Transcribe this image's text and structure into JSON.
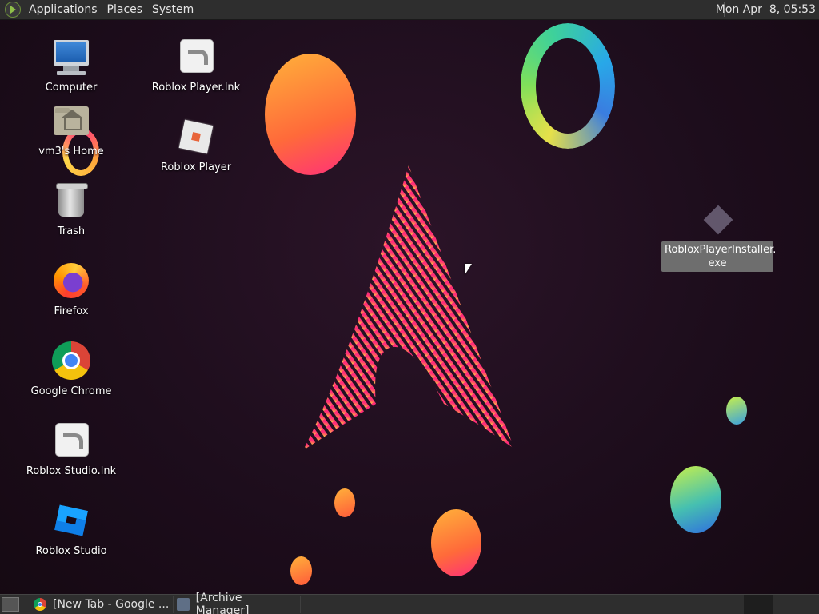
{
  "top_panel": {
    "menus": [
      "Applications",
      "Places",
      "System"
    ],
    "clock": "Mon Apr  8, 05:53"
  },
  "desktop": {
    "icons": [
      {
        "label": "Computer",
        "icon": "computer-icon"
      },
      {
        "label": "vm3's Home",
        "icon": "home-folder-icon"
      },
      {
        "label": "Trash",
        "icon": "trash-icon"
      },
      {
        "label": "Firefox",
        "icon": "firefox-icon"
      },
      {
        "label": "Google Chrome",
        "icon": "chrome-icon"
      },
      {
        "label": "Roblox Studio.lnk",
        "icon": "shortcut-icon"
      },
      {
        "label": "Roblox Studio",
        "icon": "roblox-studio-icon"
      },
      {
        "label": "Roblox Player.lnk",
        "icon": "shortcut-icon"
      },
      {
        "label": "Roblox Player",
        "icon": "roblox-player-icon"
      },
      {
        "label": "RobloxPlayerInstaller.\nexe",
        "icon": "installer-icon"
      }
    ]
  },
  "taskbar": {
    "tasks": [
      {
        "label": "[New Tab - Google ...",
        "icon": "chrome-icon"
      },
      {
        "label": "[Archive Manager]",
        "icon": "archive-manager-icon"
      }
    ]
  },
  "colors": {
    "panel": "#2e2e2e",
    "desktop_bg": "#1d0d1c",
    "accent_pink": "#ff2d78",
    "accent_orange": "#ffa53a"
  }
}
